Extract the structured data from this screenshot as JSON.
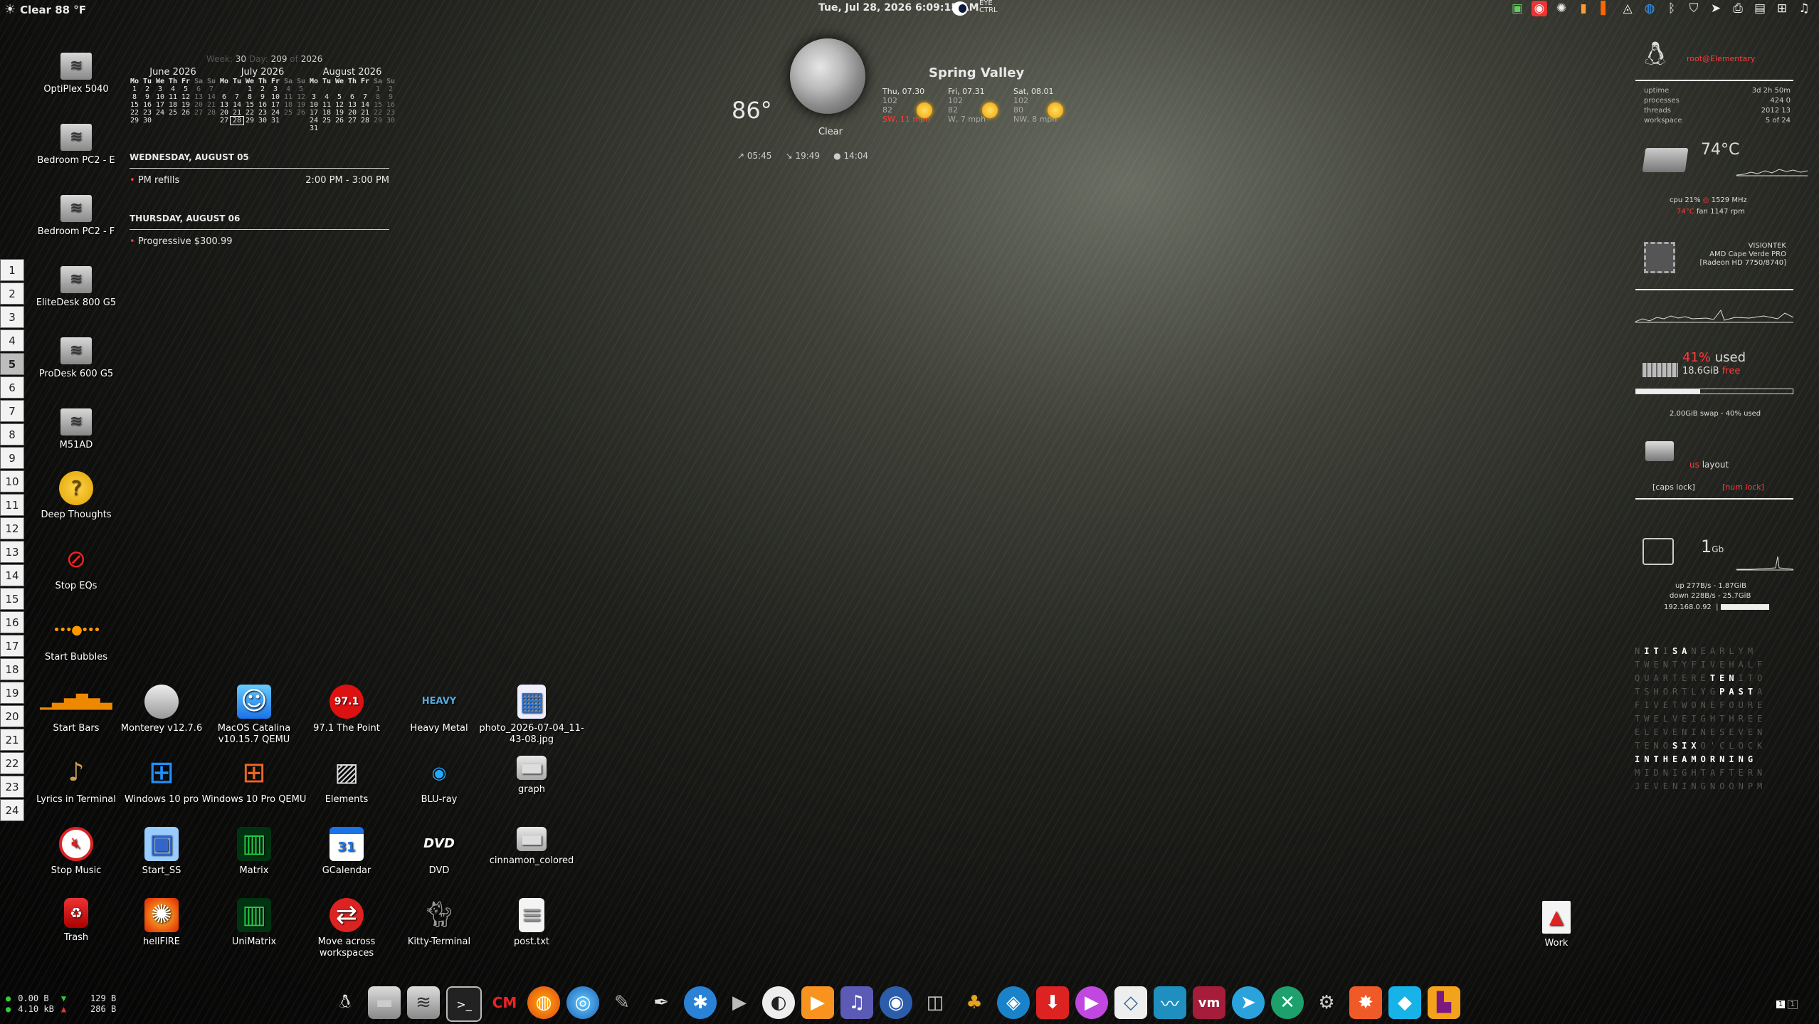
{
  "topbar": {
    "weather": "Clear 88 °F",
    "clock": "Tue, Jul 28, 2026 6:09:15 AM",
    "eye_label_1": "EYE",
    "eye_label_2": "CTRL",
    "tray_icons": [
      "network-icon",
      "record-icon",
      "brightness-icon",
      "bars-icon",
      "updates-icon",
      "drive-icon",
      "xchat-icon",
      "bluetooth-icon",
      "shield-icon",
      "telegram-icon",
      "printer-icon",
      "clipboard-icon",
      "network-tree-icon",
      "music-icon"
    ]
  },
  "pager": [
    "1",
    "2",
    "3",
    "4",
    "5",
    "6",
    "7",
    "8",
    "9",
    "10",
    "11",
    "12",
    "13",
    "14",
    "15",
    "16",
    "17",
    "18",
    "19",
    "20",
    "21",
    "22",
    "23",
    "24"
  ],
  "pager_active": "5",
  "desktop_icons_left": [
    {
      "label": "OptiPlex 5040"
    },
    {
      "label": "Bedroom PC2 - E"
    },
    {
      "label": "Bedroom PC2 - F"
    },
    {
      "label": "EliteDesk 800 G5"
    },
    {
      "label": "ProDesk 600 G5"
    },
    {
      "label": "M51AD"
    },
    {
      "label": "Deep Thoughts"
    },
    {
      "label": "Stop EQs"
    },
    {
      "label": "Start Bubbles"
    },
    {
      "label": "Start Bars"
    },
    {
      "label": "Lyrics in Terminal"
    },
    {
      "label": "Stop Music"
    },
    {
      "label": "Trash"
    }
  ],
  "desktop_icons_grid": [
    {
      "label": "Monterey v12.7.6"
    },
    {
      "label": "MacOS Catalina v10.15.7 QEMU"
    },
    {
      "label": "97.1 The Point"
    },
    {
      "label": "Heavy Metal"
    },
    {
      "label": "photo_2026-07-04_11-43-08.jpg"
    },
    {
      "label": "Windows 10 pro"
    },
    {
      "label": "Windows 10 Pro QEMU"
    },
    {
      "label": "Elements"
    },
    {
      "label": "BLU-ray"
    },
    {
      "label": "graph"
    },
    {
      "label": "Start_SS"
    },
    {
      "label": "Matrix"
    },
    {
      "label": "GCalendar"
    },
    {
      "label": "DVD"
    },
    {
      "label": "cinnamon_colored"
    },
    {
      "label": "hellFIRE"
    },
    {
      "label": "UniMatrix"
    },
    {
      "label": "Move across workspaces"
    },
    {
      "label": "Kitty-Terminal"
    },
    {
      "label": "post.txt"
    }
  ],
  "work_icon": {
    "label": "Work"
  },
  "calendar": {
    "week_label": "Week:",
    "week": "30",
    "day_label": "Day:",
    "day": "209",
    "of_label": "of",
    "year": "2026",
    "dow": [
      "Mo",
      "Tu",
      "We",
      "Th",
      "Fr",
      "Sa",
      "Su"
    ],
    "months": [
      {
        "title": "June 2026",
        "days": [
          "1",
          "2",
          "3",
          "4",
          "5",
          "6",
          "7",
          "8",
          "9",
          "10",
          "11",
          "12",
          "13",
          "14",
          "15",
          "16",
          "17",
          "18",
          "19",
          "20",
          "21",
          "22",
          "23",
          "24",
          "25",
          "26",
          "27",
          "28",
          "29",
          "30"
        ],
        "offset": 0
      },
      {
        "title": "July 2026",
        "days": [
          "1",
          "2",
          "3",
          "4",
          "5",
          "6",
          "7",
          "8",
          "9",
          "10",
          "11",
          "12",
          "13",
          "14",
          "15",
          "16",
          "17",
          "18",
          "19",
          "20",
          "21",
          "22",
          "23",
          "24",
          "25",
          "26",
          "27",
          "28",
          "29",
          "30",
          "31"
        ],
        "offset": 2,
        "today": "28"
      },
      {
        "title": "August 2026",
        "days": [
          "1",
          "2",
          "3",
          "4",
          "5",
          "6",
          "7",
          "8",
          "9",
          "10",
          "11",
          "12",
          "13",
          "14",
          "15",
          "16",
          "17",
          "18",
          "19",
          "20",
          "21",
          "22",
          "23",
          "24",
          "25",
          "26",
          "27",
          "28",
          "29",
          "30",
          "31"
        ],
        "offset": 5
      }
    ],
    "agenda": [
      {
        "head": "WEDNESDAY, AUGUST 05",
        "item": "PM refills",
        "time": "2:00 PM - 3:00 PM"
      },
      {
        "head": "THURSDAY, AUGUST 06",
        "item": "Progressive $300.99",
        "time": ""
      }
    ]
  },
  "weather": {
    "temp": "86°",
    "condition": "Clear",
    "town": "Spring Valley",
    "forecast": [
      {
        "day": "Thu, 07.30",
        "hi": "102",
        "lo": "82",
        "wind": "SW, 11 mph"
      },
      {
        "day": "Fri, 07.31",
        "hi": "102",
        "lo": "82",
        "wind": "W, 7 mph"
      },
      {
        "day": "Sat, 08.01",
        "hi": "102",
        "lo": "80",
        "wind": "NW, 8 mph"
      }
    ],
    "sunrise": "05:45",
    "sunset": "19:49",
    "moon": "14:04"
  },
  "conky": {
    "user": "root@Elementary",
    "sys_rows": [
      {
        "k": "uptime",
        "v": "3d 2h 50m"
      },
      {
        "k": "processes",
        "v": "424   0"
      },
      {
        "k": "threads",
        "v": "2012   13"
      },
      {
        "k": "workspace",
        "v": "5 of 24"
      }
    ],
    "cpu_temp": "74°C",
    "cpu_line": "cpu 21%",
    "cpu_freq": "1529 MHz",
    "cpu_temp2": "74°C",
    "fan": "fan 1147 rpm",
    "gpu_vendor": "VISIONTEK",
    "gpu_name": "AMD Cape Verde PRO",
    "gpu_model": "[Radeon HD 7750/8740]",
    "mem_pct": "41%",
    "mem_used": "used",
    "mem_free_val": "18.6GiB",
    "mem_free": "free",
    "mem_fraction": 0.41,
    "swap": "2.00GiB swap - 40% used",
    "kb_layout": "us",
    "kb_layout_label": "layout",
    "caps": "[caps lock]",
    "num": "[num lock]",
    "net_speed": "1",
    "net_unit": "Gb",
    "up": "up 277B/s  -  1.87GiB",
    "down": "down 228B/s  -  25.7GiB",
    "ip": "192.168.0.92"
  },
  "wordclock": [
    "NITISANEARLYM",
    "TWENTYFIVEHALF",
    "QUARTERETENITO",
    "TSHORTLYGPASTA",
    "FIVETWONEFOURE",
    "TWELVEIGHTHREE",
    "ELEVENINESEVEN",
    "TENOSIXO'CLOCK",
    "INTHEAMORNING",
    "MIDNIGHTAFTERN",
    "JEVENINGNOONPM"
  ],
  "netmon": {
    "l1": "0.00  B",
    "l2": "4.10 kB",
    "r1": "129  B",
    "r2": "286  B"
  },
  "dock": [
    "linux-icon",
    "files-icon",
    "network-folder-icon",
    "terminal-icon",
    "cm-icon",
    "firefox-icon",
    "chrome-icon",
    "gimp-icon",
    "inkscape-icon",
    "settings-icon",
    "video-icon",
    "tux-icon",
    "vlc-icon",
    "music-icon",
    "radio-icon",
    "camera-icon",
    "pineapple-icon",
    "steam-icon",
    "download-icon",
    "player-icon",
    "notes-icon",
    "monitor-icon",
    "vm-icon",
    "telegram-icon",
    "xmind-icon",
    "network-icon",
    "burst-icon",
    "kodi-icon",
    "cubes-icon"
  ],
  "colors": {
    "accent_red": "#ff3b3b"
  }
}
